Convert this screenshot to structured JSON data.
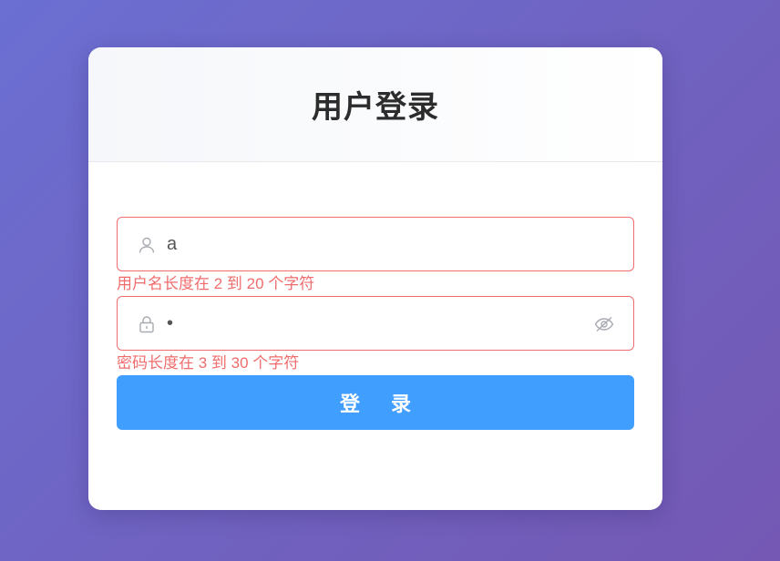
{
  "login": {
    "title": "用户登录",
    "username": {
      "value": "a",
      "placeholder": "",
      "error": "用户名长度在 2 到 20 个字符",
      "icon": "user-icon"
    },
    "password": {
      "value": "•",
      "placeholder": "",
      "error": "密码长度在 3 到 30 个字符",
      "icon": "lock-icon",
      "toggle_icon": "eye-slash-icon"
    },
    "submit_label": "登 录"
  },
  "colors": {
    "primary": "#409eff",
    "error": "#f06c6c",
    "title": "#2c2c2c",
    "background_start": "#6b6fd2",
    "background_end": "#7458b4"
  }
}
